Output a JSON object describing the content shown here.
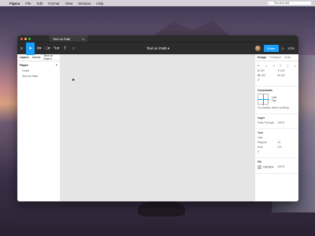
{
  "menubar": {
    "apple": "",
    "app": "Figma",
    "items": [
      "File",
      "Edit",
      "Format",
      "View",
      "Window",
      "Help"
    ],
    "time": "Thu 8:41 AM"
  },
  "window": {
    "tab_title": "Text on Path",
    "close_glyph": "×",
    "doc_title": "Text on Path ▾",
    "zoom": "14%",
    "share_label": "Share",
    "play_glyph": "▷"
  },
  "toolbar": {
    "tools": [
      {
        "name": "menu-icon",
        "glyph": "≡",
        "active": false
      },
      {
        "name": "move-tool-icon",
        "glyph": "➤",
        "active": true
      },
      {
        "name": "frame-tool-icon",
        "glyph": "#▾",
        "active": false
      },
      {
        "name": "shape-tool-icon",
        "glyph": "□▾",
        "active": false
      },
      {
        "name": "pen-tool-icon",
        "glyph": "✎▾",
        "active": false
      },
      {
        "name": "text-tool-icon",
        "glyph": "T",
        "active": false
      },
      {
        "name": "comment-tool-icon",
        "glyph": "○",
        "active": false
      }
    ]
  },
  "left_panel": {
    "tabs": [
      "Layers",
      "Assets"
    ],
    "page_selector": "Text on Path ▾",
    "pages_label": "Pages",
    "add_glyph": "+",
    "pages": [
      "Cover",
      "Text on Path"
    ]
  },
  "right_panel": {
    "tabs": [
      "Design",
      "Prototype",
      "Code"
    ],
    "transform": {
      "x": "X",
      "y": "Y",
      "w": "W",
      "h": "H",
      "rot": "0°",
      "x_val": "100",
      "y_val": "100",
      "w_val": "100",
      "h_val": "100"
    },
    "constraints": {
      "title": "Constraints",
      "horizontal": "Left",
      "vertical": "Top",
      "fix_label": "Fix position when scrolling"
    },
    "layer": {
      "title": "Layer",
      "blend": "Pass Through",
      "opacity": "100%"
    },
    "text": {
      "title": "Text",
      "font": "Inter",
      "weight": "Regular",
      "size": "12",
      "line_height": "Auto",
      "letter_spacing": "0%",
      "paragraph": "0"
    },
    "fill": {
      "title": "Fill",
      "hex": "C4C4C4",
      "opacity": "100%"
    }
  }
}
